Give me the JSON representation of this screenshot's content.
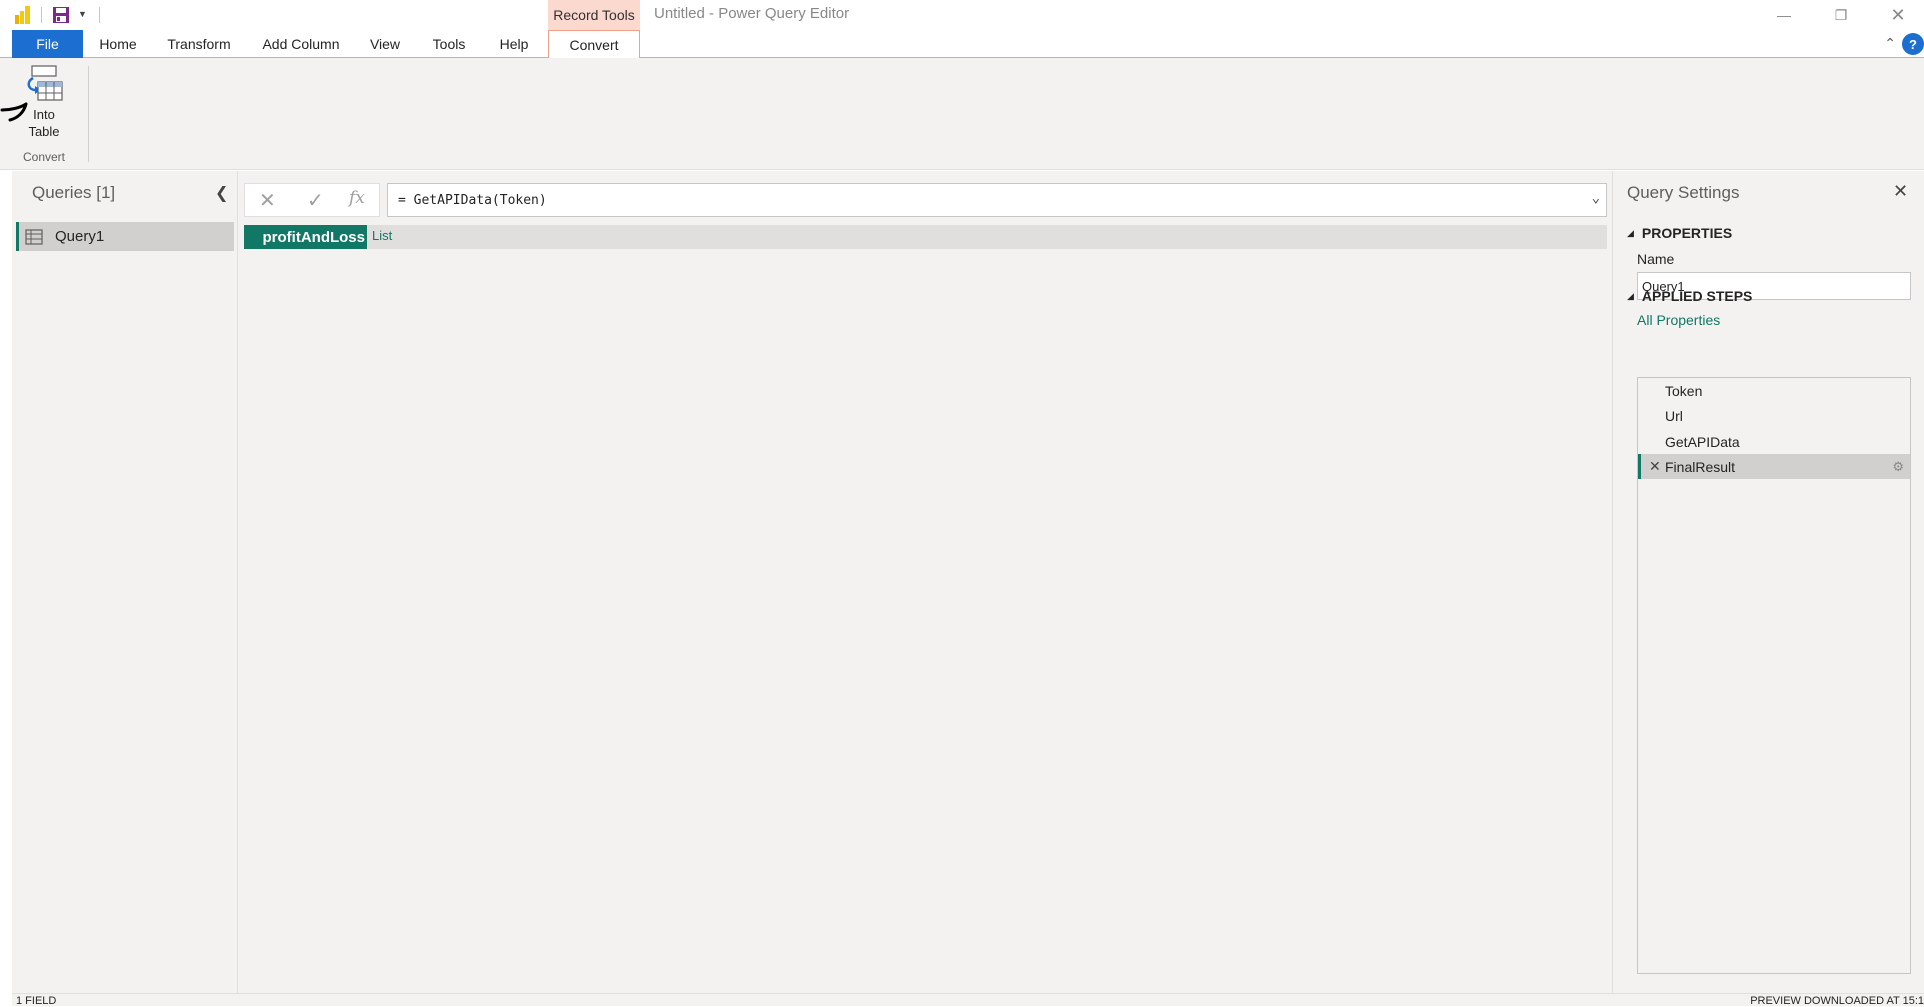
{
  "titlebar": {
    "context_tab": "Record Tools",
    "app_title": "Untitled - Power Query Editor"
  },
  "ribbon": {
    "tabs": [
      "File",
      "Home",
      "Transform",
      "Add Column",
      "View",
      "Tools",
      "Help",
      "Convert"
    ],
    "active_tab": "Convert",
    "into_table_line1": "Into",
    "into_table_line2": "Table",
    "group_label": "Convert",
    "help_icon": "?"
  },
  "queries": {
    "title": "Queries [1]",
    "items": [
      {
        "label": "Query1"
      }
    ]
  },
  "formula_bar": {
    "formula": "= GetAPIData(Token)",
    "cancel_icon": "✕",
    "commit_icon": "✓",
    "fx_icon": "fx"
  },
  "record": {
    "field": "profitAndLoss",
    "value": "List"
  },
  "settings": {
    "title": "Query Settings",
    "properties_header": "PROPERTIES",
    "name_label": "Name",
    "name_value": "Query1",
    "all_properties": "All Properties",
    "applied_steps_header": "APPLIED STEPS",
    "steps": [
      "Token",
      "Url",
      "GetAPIData",
      "FinalResult"
    ],
    "selected_step": "FinalResult"
  },
  "status": {
    "left": "1 FIELD",
    "right": "PREVIEW DOWNLOADED AT 15:1"
  },
  "colors": {
    "accent_green": "#117865",
    "file_blue": "#1c6fd1",
    "context_tab": "#fbd9cf"
  }
}
